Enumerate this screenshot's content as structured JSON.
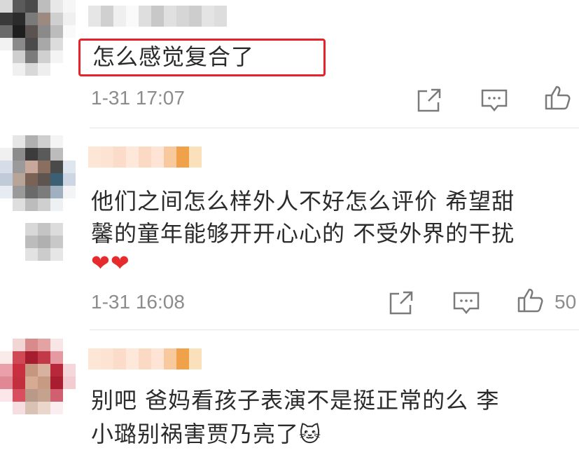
{
  "comments": [
    {
      "text": "怎么感觉复合了",
      "time": "1-31 17:07",
      "likes": ""
    },
    {
      "text_line1": "他们之间怎么样外人不好怎么评价  希望甜",
      "text_line2": "馨的童年能够开开心心的 不受外界的干扰",
      "emoji": "❤❤",
      "time": "1-31 16:08",
      "likes": "50"
    },
    {
      "text_line1": "别吧  爸妈看孩子表演不是挺正常的么   李",
      "text_line2": "小璐别祸害贾乃亮了",
      "emoji": "🐱",
      "time": "",
      "likes": ""
    }
  ],
  "icons": [
    "share-icon",
    "comment-icon",
    "like-icon"
  ],
  "colors": {
    "highlight": "#e8222a",
    "meta": "#8c8c8c",
    "divider": "#e6e6e6",
    "text": "#2b2b2b"
  }
}
